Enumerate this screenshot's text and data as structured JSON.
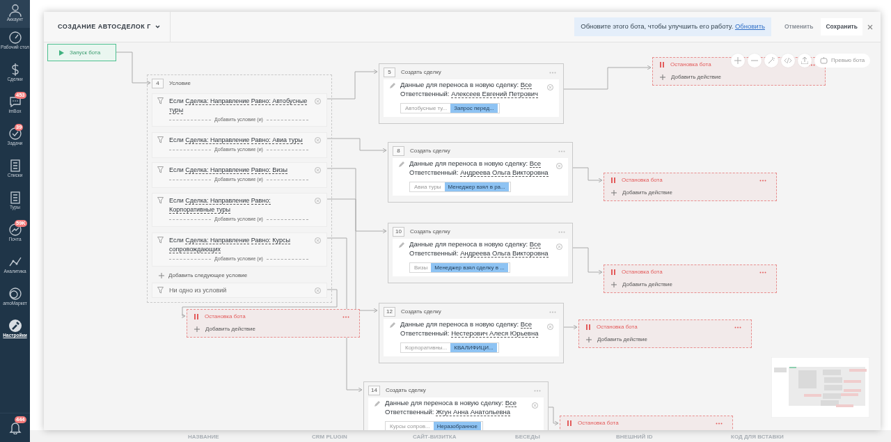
{
  "sidebar": {
    "items": [
      {
        "label": "Аккаунт",
        "selected": false
      },
      {
        "label": "Рабочий стол",
        "selected": false
      },
      {
        "label": "Сделки",
        "selected": false
      },
      {
        "label": "imBox",
        "badge": "453",
        "selected": false
      },
      {
        "label": "Задачи",
        "badge": "39",
        "selected": false
      },
      {
        "label": "Списки",
        "selected": false
      },
      {
        "label": "Туры",
        "selected": false
      },
      {
        "label": "Почта",
        "badge": "59K",
        "selected": false
      },
      {
        "label": "Аналитика",
        "selected": false
      },
      {
        "label": "amoМаркет",
        "selected": false
      },
      {
        "label": "Настройки",
        "selected": true
      }
    ],
    "notifications": {
      "badge": "444"
    }
  },
  "header": {
    "title": "СОЗДАНИЕ АВТОСДЕЛОК Г",
    "notice": "Обновите этого бота, чтобы улучшить его работу.",
    "notice_link": "Обновить",
    "cancel": "Отменить",
    "save": "Сохранить"
  },
  "toolbar": {
    "preview": "Превью бота"
  },
  "start": {
    "label": "Запуск бота"
  },
  "condition": {
    "number": "4",
    "title": "Условие",
    "branches": [
      {
        "prefix": "Если",
        "field": "Сделка: Направление",
        "operator": "Равно:",
        "value": "Автобусные туры",
        "add": "Добавить условие (и)"
      },
      {
        "prefix": "Если",
        "field": "Сделка: Направление",
        "operator": "Равно:",
        "value": "Авиа туры",
        "add": "Добавить условие (и)"
      },
      {
        "prefix": "Если",
        "field": "Сделка: Направление",
        "operator": "Равно:",
        "value": "Визы",
        "add": "Добавить условие (и)"
      },
      {
        "prefix": "Если",
        "field": "Сделка: Направление",
        "operator": "Равно:",
        "value": "Корпоративные туры",
        "add": "Добавить условие (и)"
      },
      {
        "prefix": "Если",
        "field": "Сделка: Направление",
        "operator": "Равно:",
        "value": "Курсы сопровождающих",
        "add": "Добавить условие (и)"
      }
    ],
    "add_next": "Добавить следующее условие",
    "otherwise": "Ни одно из условий"
  },
  "actions": [
    {
      "number": "5",
      "title": "Создать сделку",
      "data_label": "Данные для переноса в новую сделку:",
      "data_value": "Все",
      "owner_label": "Ответственный:",
      "owner": "Алексеев Евгений Петрович",
      "pipeline": "Автобусные ту...",
      "stage": "Запрос перед..."
    },
    {
      "number": "8",
      "title": "Создать сделку",
      "data_label": "Данные для переноса в новую сделку:",
      "data_value": "Все",
      "owner_label": "Ответственный:",
      "owner": "Андреева Ольга Викторовна",
      "pipeline": "Авиа туры",
      "stage": "Менеджер взял в ра..."
    },
    {
      "number": "10",
      "title": "Создать сделку",
      "data_label": "Данные для переноса в новую сделку:",
      "data_value": "Все",
      "owner_label": "Ответственный:",
      "owner": "Андреева Ольга Викторовна",
      "pipeline": "Визы",
      "stage": "Менеджер взял сделку в ..."
    },
    {
      "number": "12",
      "title": "Создать сделку",
      "data_label": "Данные для переноса в новую сделку:",
      "data_value": "Все",
      "owner_label": "Ответственный:",
      "owner": "Нестерович Алеся Юрьевна",
      "pipeline": "Корпоративны...",
      "stage": "КВАЛИФИЦИ..."
    },
    {
      "number": "14",
      "title": "Создать сделку",
      "data_label": "Данные для переноса в новую сделку:",
      "data_value": "Все",
      "owner_label": "Ответственный:",
      "owner": "Жгун Анна Анатольевна",
      "pipeline": "Курсы сопров...",
      "stage": "Неразобранное"
    }
  ],
  "stops": [
    {
      "title": "Остановка бота",
      "add": "Добавить действие"
    },
    {
      "title": "Остановка бота",
      "add": "Добавить действие"
    },
    {
      "title": "Остановка бота",
      "add": "Добавить действие"
    },
    {
      "title": "Остановка бота",
      "add": "Добавить действие"
    },
    {
      "title": "Остановка бота",
      "add": "Добавить действие"
    },
    {
      "title": "Остановка бота"
    }
  ],
  "table_header": {
    "columns": [
      "НАЗВАНИЕ",
      "CRM PLUGIN",
      "САЙТ-ВИЗИТКА",
      "БЕСЕДЫ",
      "ВНЕШНИЙ ID",
      "КОД ДЛЯ ВСТАВКИ"
    ]
  }
}
